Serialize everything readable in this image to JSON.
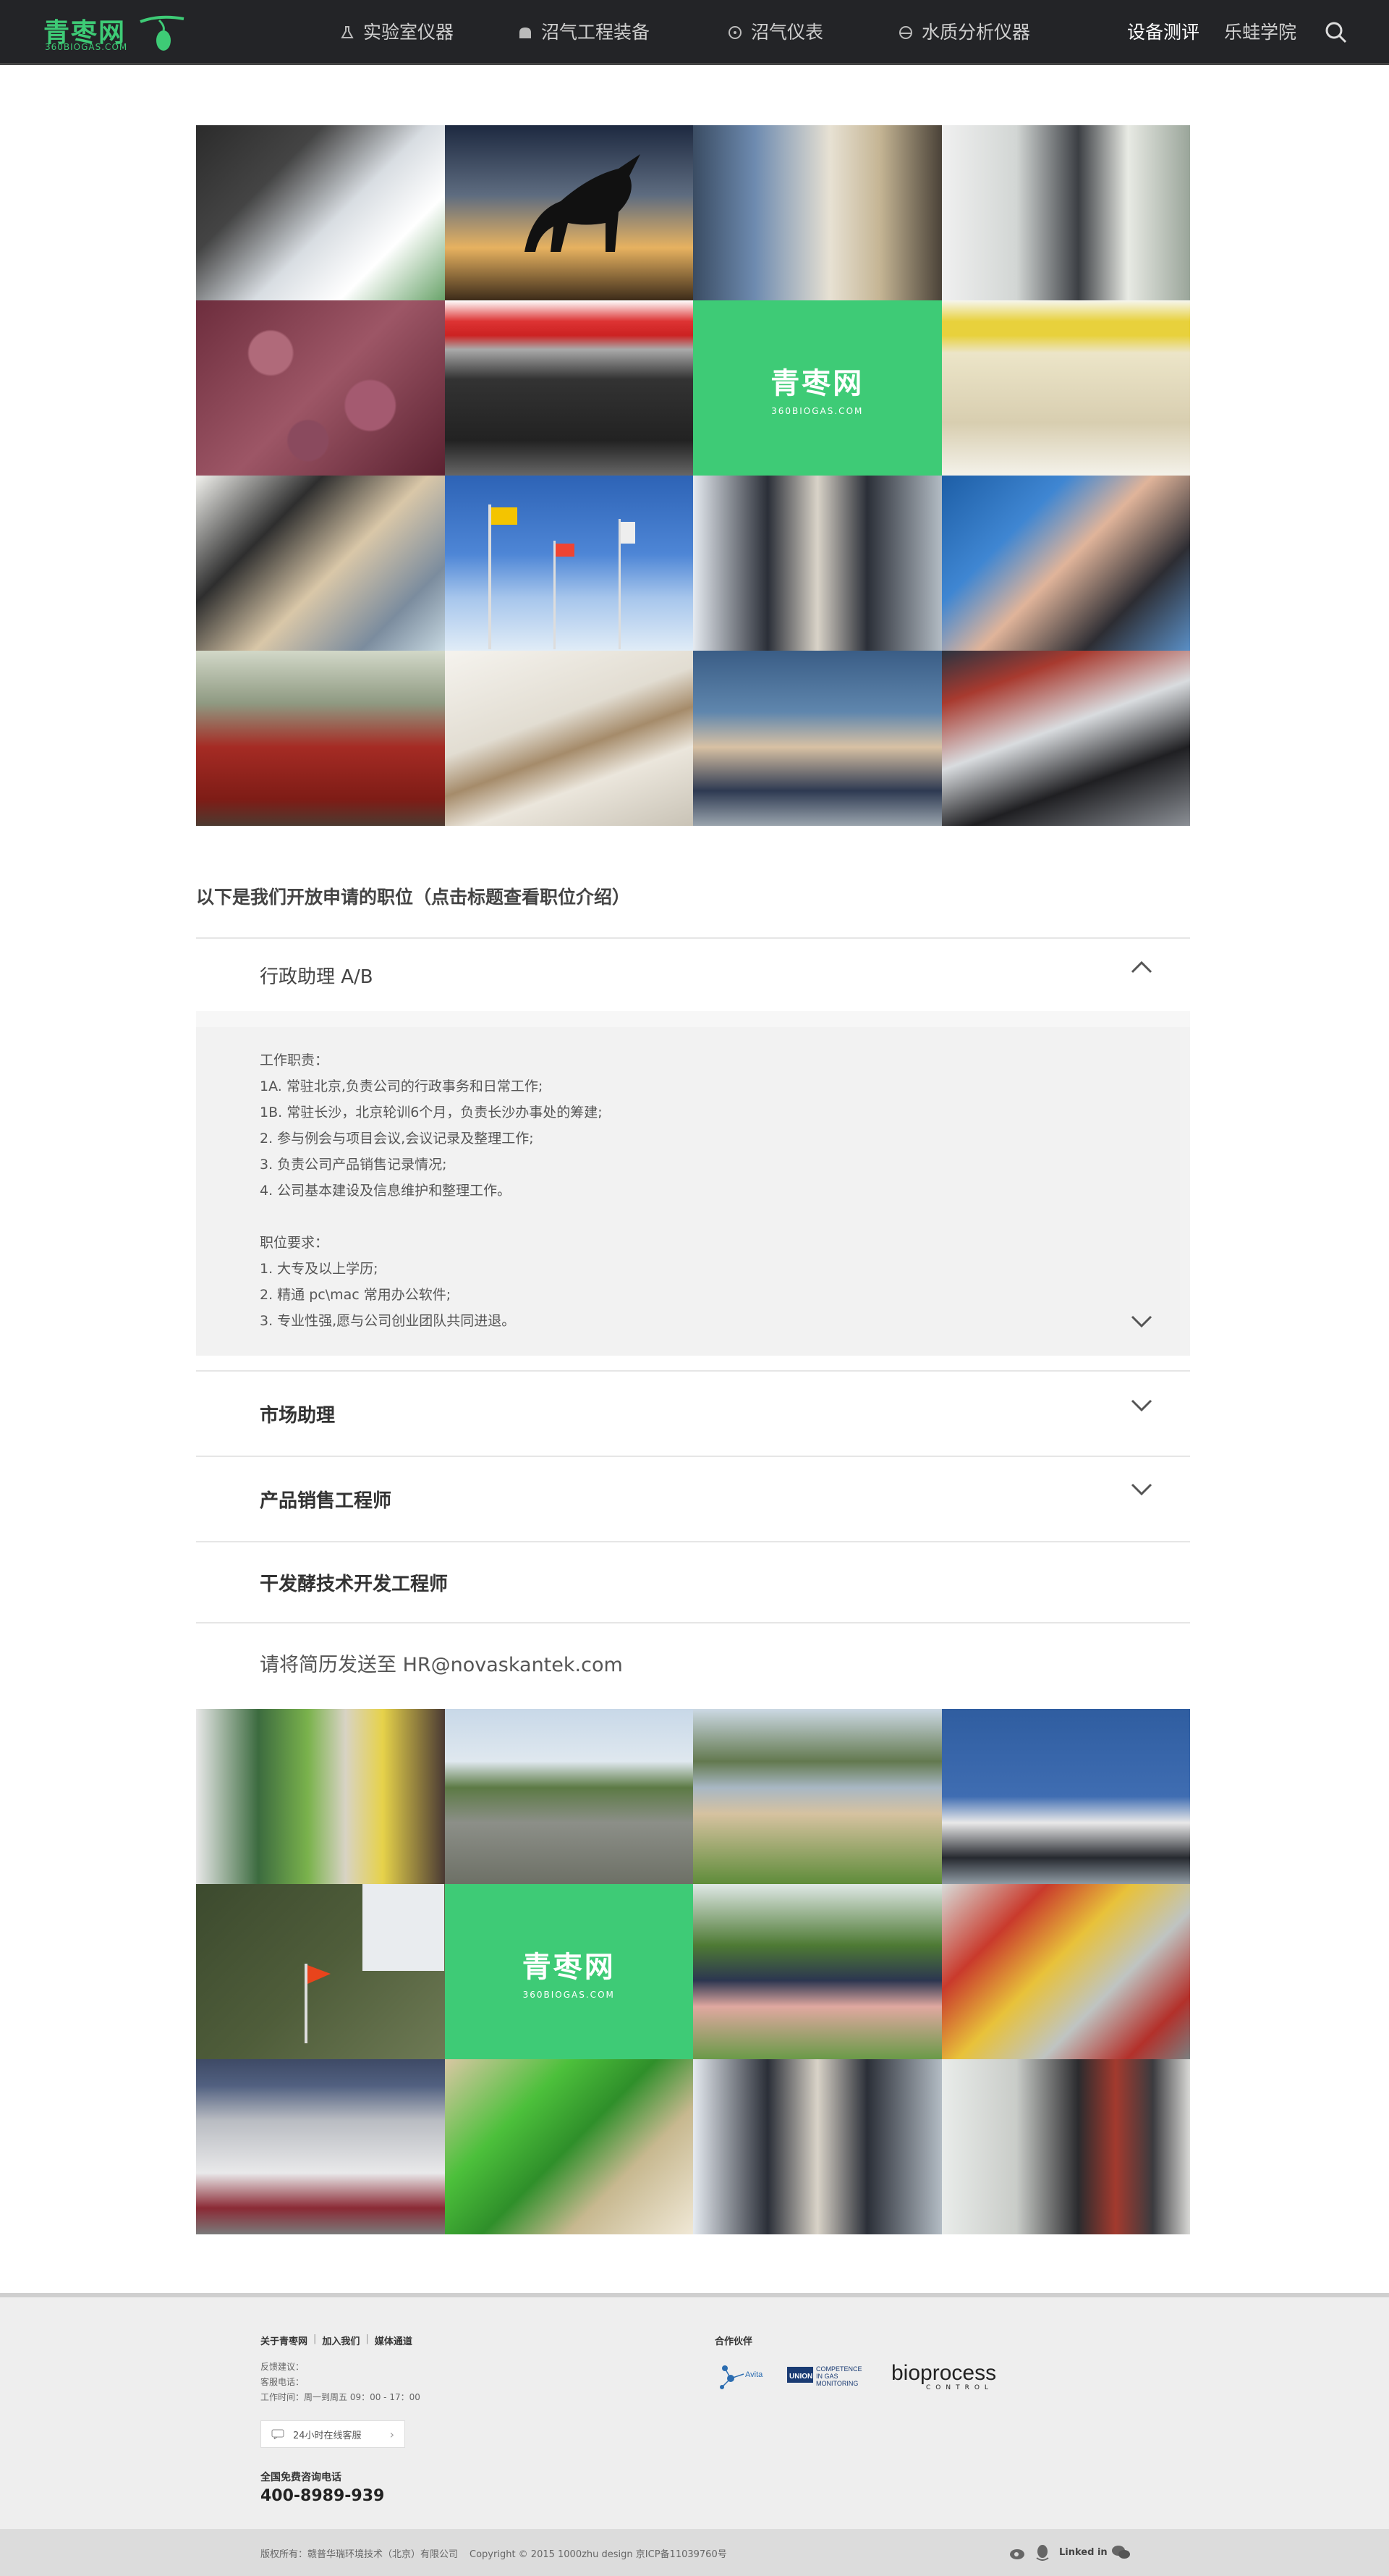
{
  "nav": {
    "logo_cn": "青枣网",
    "logo_en": "360BIOGAS.COM",
    "items": [
      {
        "label": "实验室仪器",
        "icon": "flask-icon"
      },
      {
        "label": "沼气工程装备",
        "icon": "tank-icon"
      },
      {
        "label": "沼气仪表",
        "icon": "gauge-icon"
      },
      {
        "label": "水质分析仪器",
        "icon": "water-drop-icon"
      }
    ],
    "right_items": [
      "设备测评",
      "乐蛙学院"
    ],
    "search_icon": "search-icon"
  },
  "brand_tile": {
    "cn": "青枣网",
    "en": "360BIOGAS.COM"
  },
  "gallery_top": [
    "lab-equipment-photo",
    "bull-silhouette-photo",
    "meeting-photo",
    "exhibition-photo",
    "grapes-photo",
    "gokart-team-photo",
    "brand-tile",
    "sample-tubes-photo",
    "students-lab-photo",
    "flags-photo",
    "conference-photo",
    "helicopter-pilot-photo",
    "red-chairs-photo",
    "wall-display-photo",
    "team-sitting-photo",
    "gokart-driver-photo"
  ],
  "jobs": {
    "intro": "以下是我们开放申请的职位（点击标题查看职位介绍）",
    "items": [
      {
        "title": "行政助理 A/B",
        "expanded": true,
        "detail": [
          "工作职责：",
          "1A. 常驻北京,负责公司的行政事务和日常工作;",
          "1B. 常驻长沙，北京轮训6个月，负责长沙办事处的筹建;",
          "2. 参与例会与项目会议,会议记录及整理工作;",
          "3. 负责公司产品销售记录情况;",
          "4. 公司基本建设及信息维护和整理工作。",
          "",
          "职位要求：",
          "1. 大专及以上学历;",
          "2. 精通 pc\\mac 常用办公软件;",
          "3. 专业性强,愿与公司创业团队共同进退。"
        ]
      },
      {
        "title": "市场助理",
        "expanded": false
      },
      {
        "title": "产品销售工程师",
        "expanded": false
      },
      {
        "title": "干发酵技术开发工程师",
        "expanded": false
      }
    ],
    "contact": "请将简历发送至 HR@novaskantek.com"
  },
  "gallery_bottom": [
    "bioprocess-booth-photo",
    "biogas-plant-photo",
    "group-on-lawn-photo",
    "building-visit-photo",
    "red-flag-photo",
    "brand-tile",
    "outdoor-group-photo",
    "pipes-valves-photo",
    "institute-group-photo",
    "green-sculpture-photo",
    "conference-photo-2",
    "lab-visit-photo"
  ],
  "footer": {
    "links": [
      "关于青枣网",
      "加入我们",
      "媒体通道"
    ],
    "info": [
      "反馈建议：",
      "客服电话：",
      "工作时间：周一到周五 09：00 - 17：00"
    ],
    "chat_label": "24小时在线客服",
    "hotline_label": "全国免费咨询电话",
    "hotline": "400-8989-939",
    "partners_label": "合作伙伴",
    "partners": [
      {
        "name": "Avita",
        "icon": "avita-logo"
      },
      {
        "name": "COMPETENCE IN GAS MONITORING",
        "prefix": "UNION",
        "icon": "union-logo"
      },
      {
        "name": "bioprocess",
        "sub": "CONTROL",
        "icon": "bioprocess-logo"
      }
    ],
    "copyright": [
      "版权所有：赣普华瑞环境技术（北京）有限公司",
      "Copyright © 2015 1000zhu design 京ICP备11039760号"
    ],
    "social_icons": [
      "weibo-icon",
      "qq-icon",
      "linkedin-icon",
      "wechat-icon"
    ],
    "linkedin_text": "Linked in"
  }
}
